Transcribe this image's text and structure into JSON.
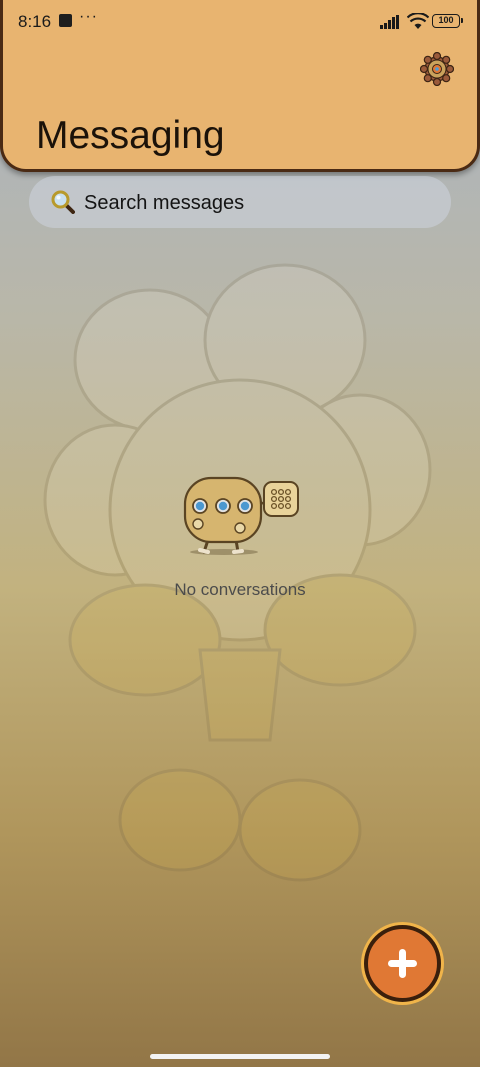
{
  "status_bar": {
    "time": "8:16",
    "notifications_more": "···",
    "battery": "100",
    "icons": [
      "notification-square-icon",
      "signal-icon",
      "wifi-icon",
      "battery-icon"
    ]
  },
  "header": {
    "title": "Messaging",
    "settings_icon": "gear-icon",
    "background_color": "#e8b470"
  },
  "search": {
    "label": "Search messages",
    "icon": "search-icon"
  },
  "empty_state": {
    "message": "No conversations",
    "illustration": "cookie-mascot-dice-icon"
  },
  "fab": {
    "icon": "plus-icon",
    "color": "#e07834"
  }
}
